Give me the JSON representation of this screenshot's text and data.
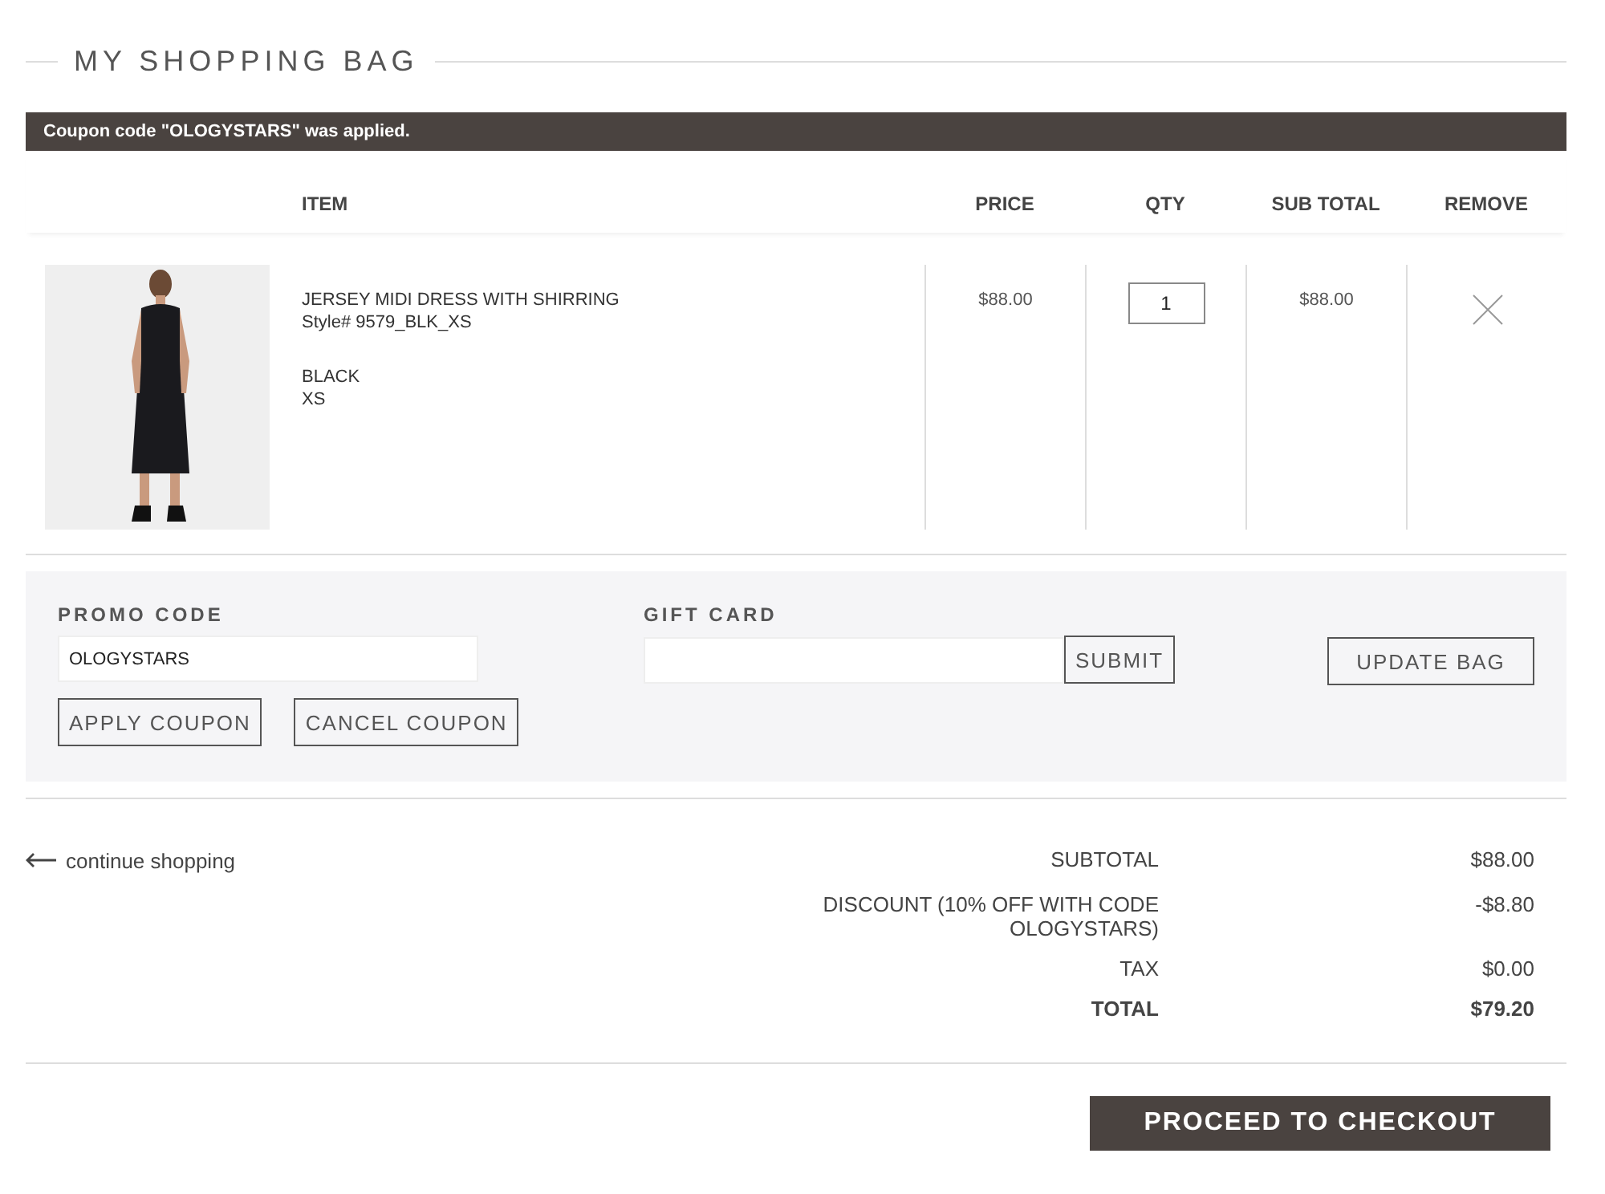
{
  "title": "MY SHOPPING BAG",
  "notice": "Coupon code \"OLOGYSTARS\" was applied.",
  "table": {
    "columns": [
      "ITEM",
      "PRICE",
      "QTY",
      "SUB TOTAL",
      "REMOVE"
    ],
    "rows": [
      {
        "name": "JERSEY MIDI DRESS WITH SHIRRING",
        "style": "Style# 9579_BLK_XS",
        "variant": "BLACK",
        "size": "XS",
        "price": "$88.00",
        "qty": "1",
        "subtotal": "$88.00"
      }
    ]
  },
  "promo": {
    "label": "PROMO CODE",
    "value": "OLOGYSTARS",
    "buttons": [
      "APPLY COUPON",
      "CANCEL COUPON"
    ]
  },
  "gift_card": {
    "label": "GIFT CARD",
    "submit": "SUBMIT"
  },
  "update_button": "UPDATE BAG",
  "continue_link": "continue shopping",
  "summary": [
    {
      "kind": "line",
      "label": "SUBTOTAL",
      "value": "$88.00"
    },
    {
      "kind": "line",
      "label": "DISCOUNT (10% OFF WITH CODE OLOGYSTARS)",
      "value": "-$8.80"
    },
    {
      "kind": "line",
      "label": "TAX",
      "value": "$0.00"
    },
    {
      "kind": "total",
      "label": "TOTAL",
      "value": "$79.20"
    }
  ],
  "checkout_button": "PROCEED TO CHECKOUT"
}
